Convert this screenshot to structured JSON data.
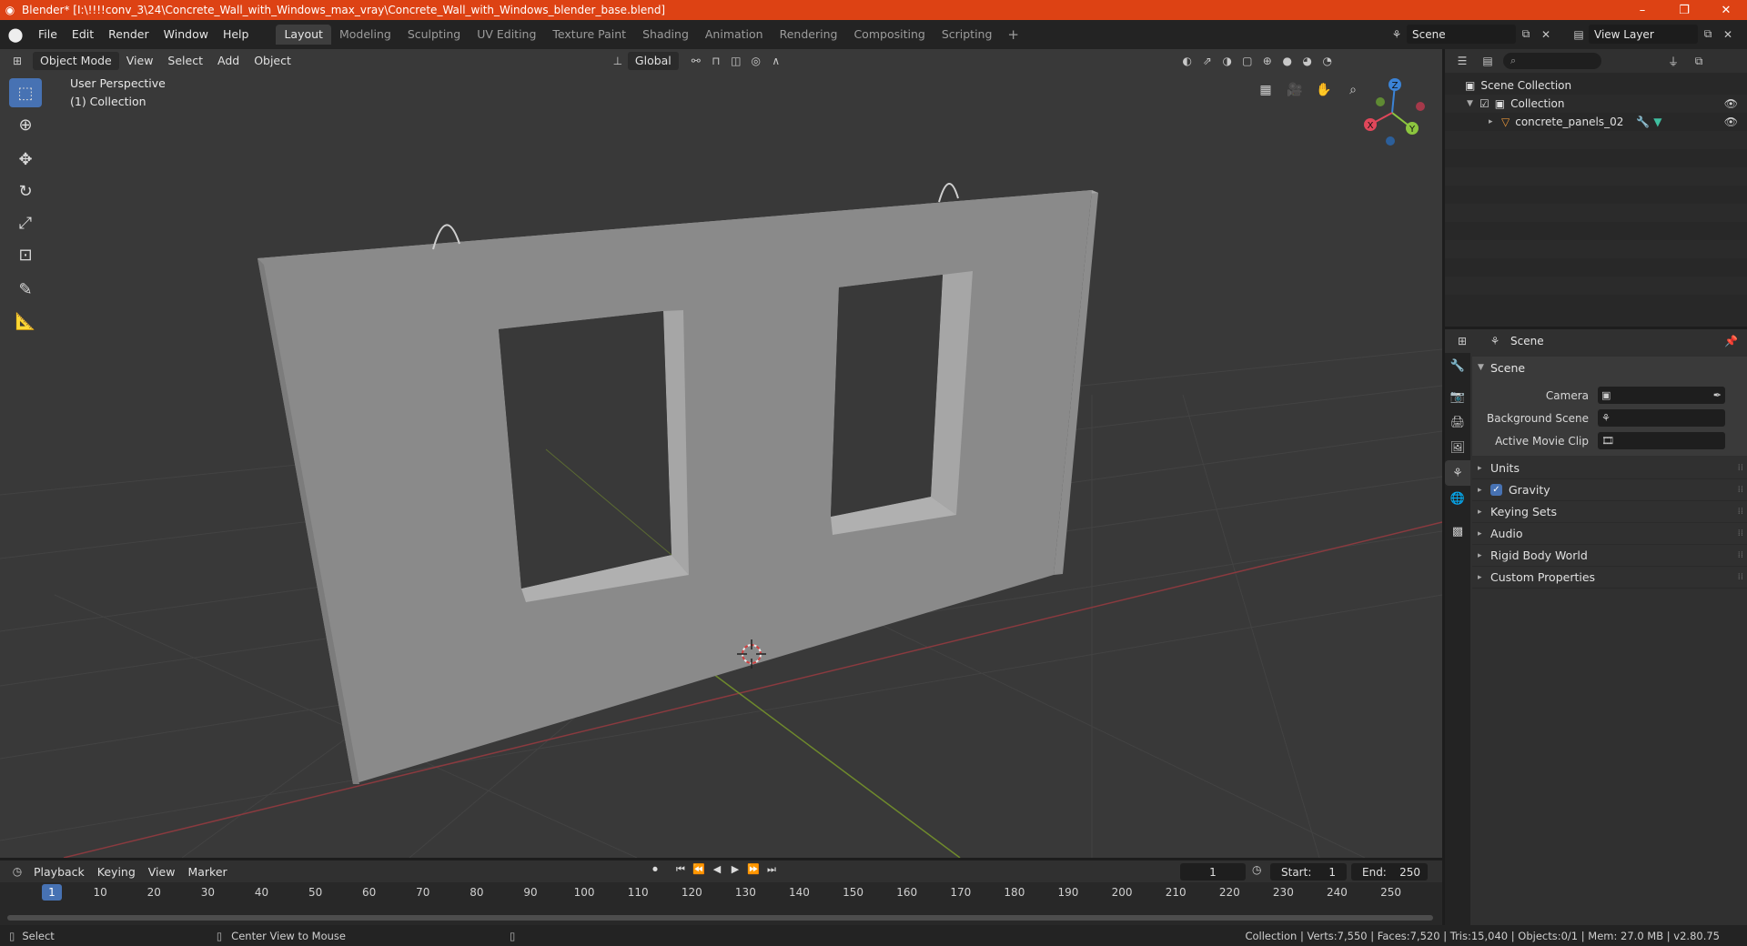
{
  "window": {
    "title": "Blender* [I:\\!!!!conv_3\\24\\Concrete_Wall_with_Windows_max_vray\\Concrete_Wall_with_Windows_blender_base.blend]",
    "minimize": "–",
    "maximize": "❐",
    "close": "✕"
  },
  "topbar": {
    "menus": [
      "File",
      "Edit",
      "Render",
      "Window",
      "Help"
    ],
    "workspaces": [
      "Layout",
      "Modeling",
      "Sculpting",
      "UV Editing",
      "Texture Paint",
      "Shading",
      "Animation",
      "Rendering",
      "Compositing",
      "Scripting"
    ],
    "active_workspace": "Layout",
    "scene": "Scene",
    "view_layer": "View Layer"
  },
  "viewport": {
    "mode": "Object Mode",
    "menus": [
      "View",
      "Select",
      "Add",
      "Object"
    ],
    "orientation": "Global",
    "perspective_label": "User Perspective",
    "collection_label": "(1) Collection",
    "gizmo_axes": {
      "x": "X",
      "y": "Y",
      "z": "Z"
    }
  },
  "outliner": {
    "search_placeholder": "",
    "root": "Scene Collection",
    "collection": "Collection",
    "object": "concrete_panels_02"
  },
  "properties": {
    "context": "Scene",
    "panel": "Scene",
    "fields": {
      "camera_label": "Camera",
      "background_label": "Background Scene",
      "movieclip_label": "Active Movie Clip"
    },
    "subpanels": [
      "Units",
      "Gravity",
      "Keying Sets",
      "Audio",
      "Rigid Body World",
      "Custom Properties"
    ],
    "gravity_checked": true
  },
  "timeline": {
    "menus": [
      "Playback",
      "Keying",
      "View",
      "Marker"
    ],
    "current_frame": "1",
    "start_label": "Start:",
    "start": "1",
    "end_label": "End:",
    "end": "250",
    "ruler": [
      "1",
      "10",
      "20",
      "30",
      "40",
      "50",
      "60",
      "70",
      "80",
      "90",
      "100",
      "110",
      "120",
      "130",
      "140",
      "150",
      "160",
      "170",
      "180",
      "190",
      "200",
      "210",
      "220",
      "230",
      "240",
      "250"
    ]
  },
  "statusbar": {
    "left_action": "Select",
    "middle_action": "Center View to Mouse",
    "stats": "Collection | Verts:7,550 | Faces:7,520 | Tris:15,040 | Objects:0/1 | Mem: 27.0 MB | v2.80.75"
  },
  "colors": {
    "titlebar": "#dd4214",
    "accent": "#4772b3",
    "viewport_bg": "#393939",
    "x_axis": "#e0475a",
    "y_axis": "#8cc63f",
    "z_axis": "#3b83d6"
  }
}
